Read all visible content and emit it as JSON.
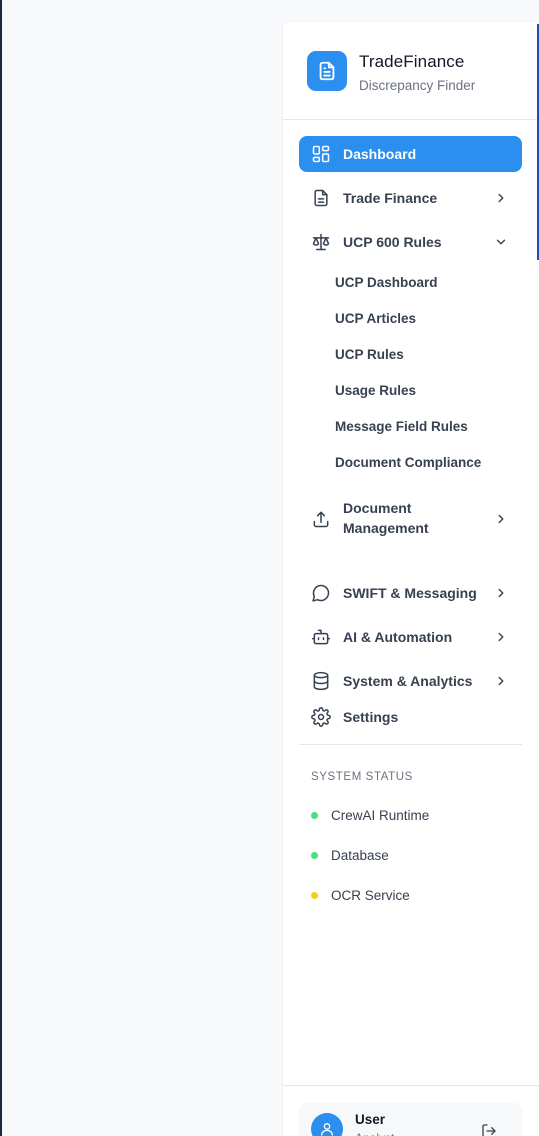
{
  "brand": {
    "title": "TradeFinance",
    "subtitle": "Discrepancy Finder",
    "logo_icon": "document-icon",
    "accent_color": "#2b8ff0"
  },
  "nav": {
    "dashboard": "Dashboard",
    "trade_finance": "Trade Finance",
    "ucp_rules": "UCP 600 Rules",
    "ucp_children": [
      "UCP Dashboard",
      "UCP Articles",
      "UCP Rules",
      "Usage Rules",
      "Message Field Rules",
      "Document Compliance"
    ],
    "document_management_line1": "Document",
    "document_management_line2": "Management",
    "swift": "SWIFT & Messaging",
    "ai": "AI & Automation",
    "system": "System & Analytics",
    "settings": "Settings"
  },
  "system_status": {
    "heading": "SYSTEM STATUS",
    "items": [
      {
        "label": "CrewAI Runtime",
        "color": "#4ade80"
      },
      {
        "label": "Database",
        "color": "#4ade80"
      },
      {
        "label": "OCR Service",
        "color": "#facc15"
      }
    ]
  },
  "user": {
    "name": "User",
    "role": "Analyst"
  }
}
